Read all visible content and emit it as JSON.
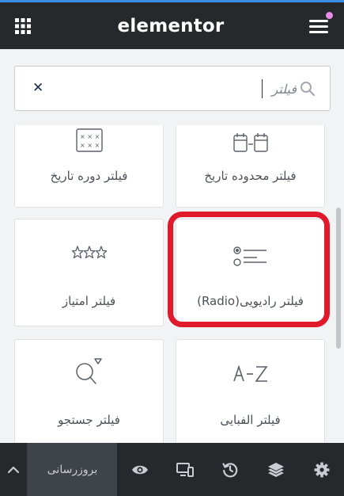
{
  "header": {
    "logo": "elementor",
    "apps_icon": "grid-icon",
    "menu_icon": "hamburger-menu-icon"
  },
  "search": {
    "placeholder": "فیلتر",
    "clear_icon": "close-icon",
    "search_icon": "search-icon"
  },
  "widgets": [
    {
      "label": "فیلتر محدوده تاریخ",
      "icon": "date-range-icon"
    },
    {
      "label": "فیلتر دوره تاریخ",
      "icon": "calendar-icon"
    },
    {
      "label": "فیلتر رادیویی(Radio)",
      "icon": "radio-list-icon"
    },
    {
      "label": "فیلتر امتیاز",
      "icon": "rating-stars-icon"
    },
    {
      "label": "فیلتر الفبایی",
      "icon": "alphabet-az-icon"
    },
    {
      "label": "فیلتر جستجو",
      "icon": "search-filter-icon"
    }
  ],
  "footer": {
    "update_label": "بروزرسانی",
    "icons": [
      "chevron-up-icon",
      "eye-icon",
      "responsive-icon",
      "history-icon",
      "layers-icon",
      "settings-icon"
    ]
  },
  "colors": {
    "header_bg": "#26292c",
    "highlight": "#e0192b",
    "notification": "#e98be8"
  }
}
